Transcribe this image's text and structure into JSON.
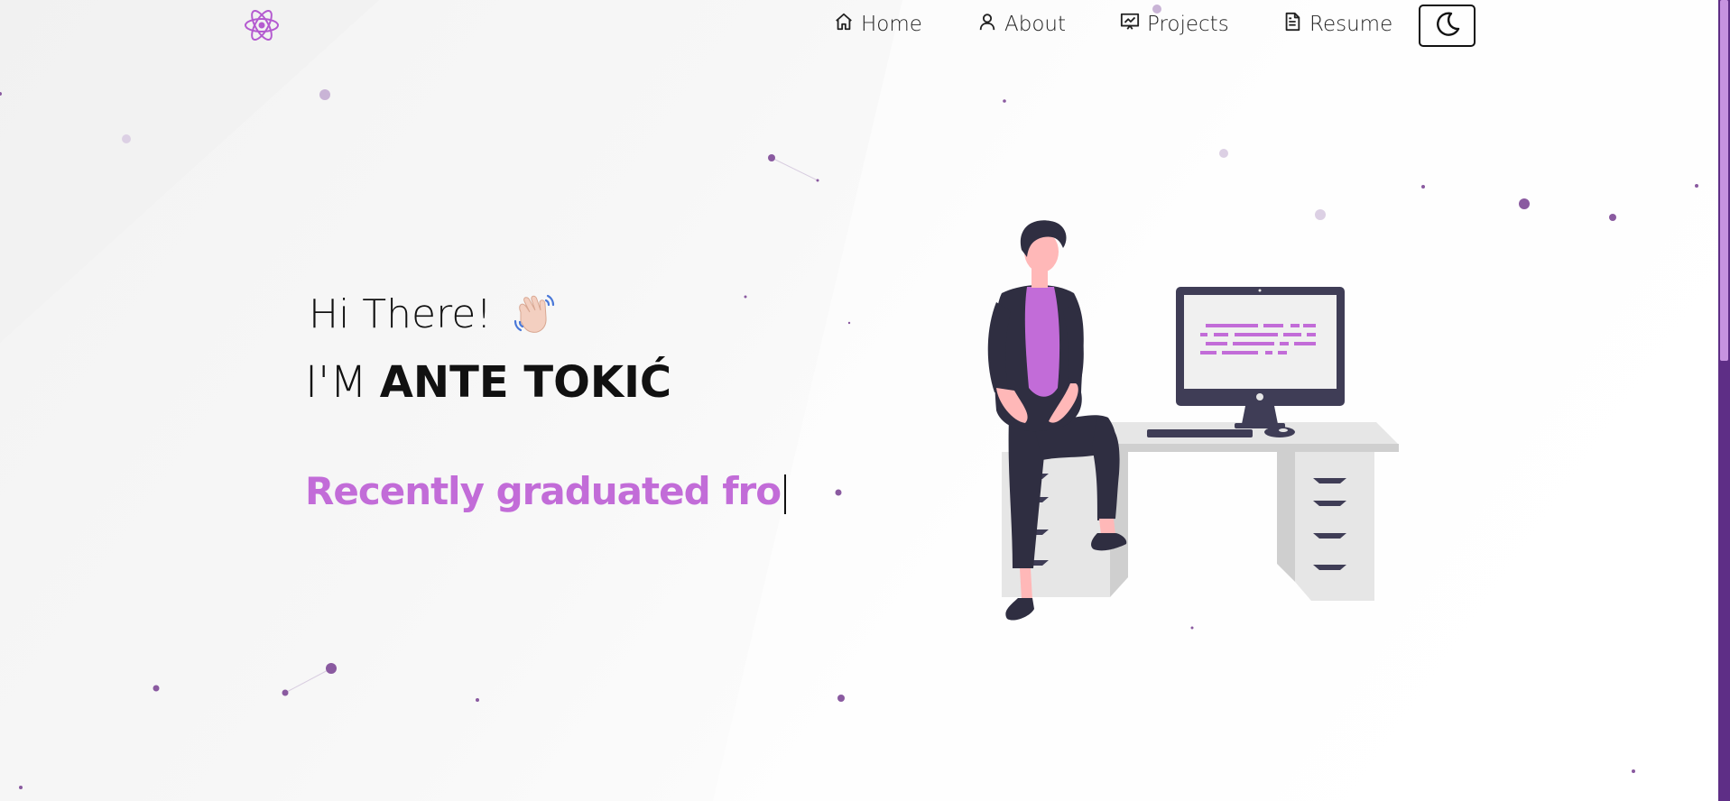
{
  "brand": {
    "logo_icon": "react-atom-icon",
    "accent_color": "#c26cd8"
  },
  "nav": {
    "items": [
      {
        "label": "Home",
        "icon": "home-icon"
      },
      {
        "label": "About",
        "icon": "user-icon"
      },
      {
        "label": "Projects",
        "icon": "presentation-icon"
      },
      {
        "label": "Resume",
        "icon": "document-icon"
      }
    ],
    "theme_toggle_icon": "moon-icon"
  },
  "hero": {
    "greeting": "Hi There!",
    "wave_icon": "waving-hand-icon",
    "intro_prefix": "I'M",
    "name": "ANTE TOKIĆ",
    "typed_text": "Recently graduated fro"
  },
  "illustration": {
    "icon": "developer-at-desk-illustration"
  },
  "colors": {
    "particle": "#8a5aa0",
    "scrollbar_track": "#5e2e86",
    "scrollbar_thumb": "#c693e0"
  }
}
